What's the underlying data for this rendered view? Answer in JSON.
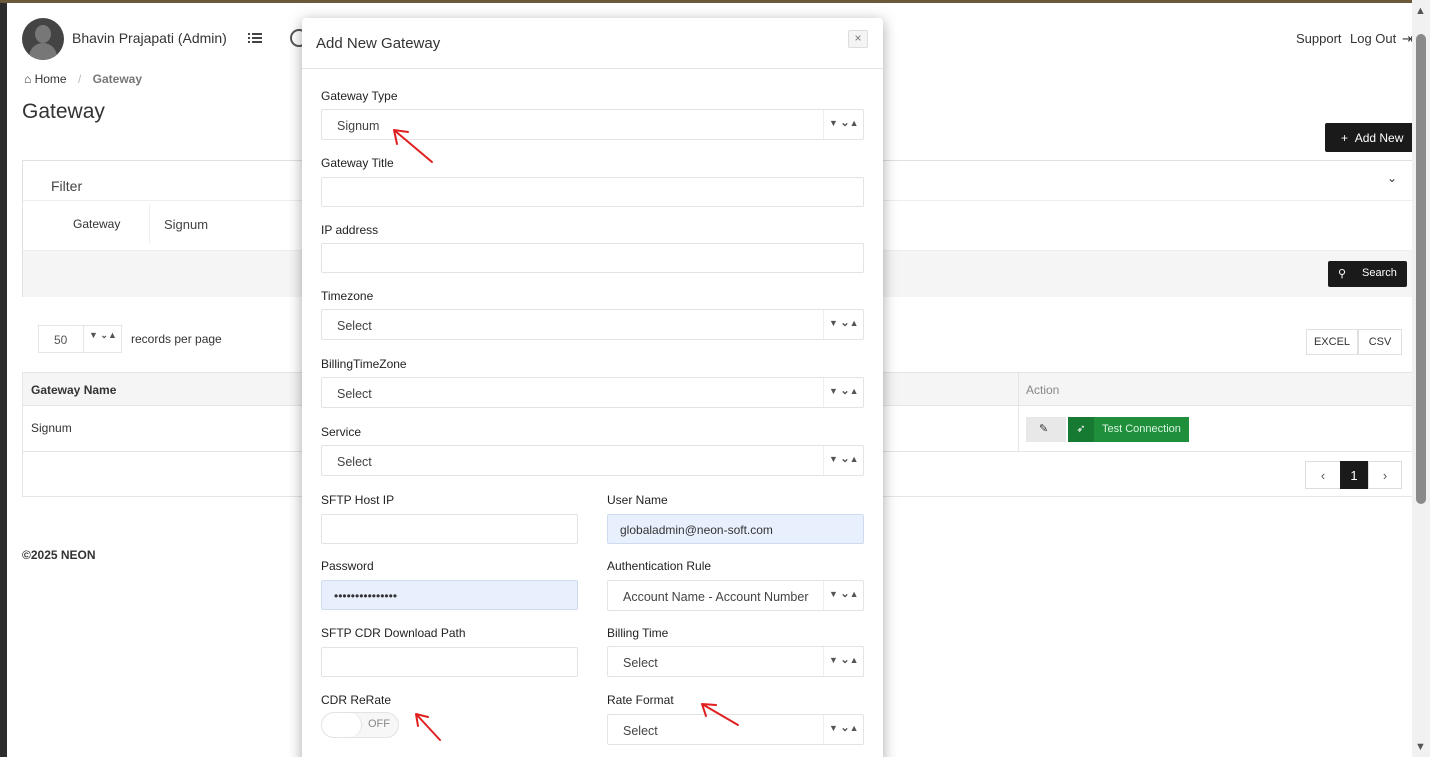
{
  "header": {
    "user_name": "Bhavin Prajapati (Admin)",
    "support": "Support",
    "logout": "Log Out"
  },
  "breadcrumb": {
    "home": "Home",
    "current": "Gateway"
  },
  "page": {
    "title": "Gateway",
    "add_new": "Add New",
    "filter_title": "Filter",
    "filter_gateway_label": "Gateway",
    "filter_gateway_value": "Signum",
    "search": "Search",
    "records_value": "50",
    "records_label": "records per page",
    "excel": "EXCEL",
    "csv": "CSV",
    "columns": {
      "name": "Gateway Name",
      "action": "Action"
    },
    "rows": [
      {
        "name": "Signum",
        "test_label": "Test Connection"
      }
    ],
    "pager": {
      "current": "1"
    },
    "footer": "©2025 NEON"
  },
  "modal": {
    "title": "Add New Gateway",
    "gateway_type": {
      "label": "Gateway Type",
      "value": "Signum"
    },
    "gateway_title": {
      "label": "Gateway Title",
      "value": ""
    },
    "ip_address": {
      "label": "IP address",
      "value": ""
    },
    "timezone": {
      "label": "Timezone",
      "value": "Select"
    },
    "billing_timezone": {
      "label": "BillingTimeZone",
      "value": "Select"
    },
    "service": {
      "label": "Service",
      "value": "Select"
    },
    "sftp_host": {
      "label": "SFTP Host IP",
      "value": ""
    },
    "user_name": {
      "label": "User Name",
      "value": "globaladmin@neon-soft.com"
    },
    "password": {
      "label": "Password",
      "value": "•••••••••••••••"
    },
    "auth_rule": {
      "label": "Authentication Rule",
      "value": "Account Name - Account Number"
    },
    "cdr_path": {
      "label": "SFTP CDR Download Path",
      "value": ""
    },
    "billing_time": {
      "label": "Billing Time",
      "value": "Select"
    },
    "cdr_rerate": {
      "label": "CDR ReRate",
      "state": "OFF"
    },
    "rate_format": {
      "label": "Rate Format",
      "value": "Select"
    }
  },
  "colors": {
    "accent_dark": "#1a1a1a",
    "success": "#1f8f3c",
    "annotation_red": "#e02020",
    "autofill": "#e8f0fe"
  }
}
